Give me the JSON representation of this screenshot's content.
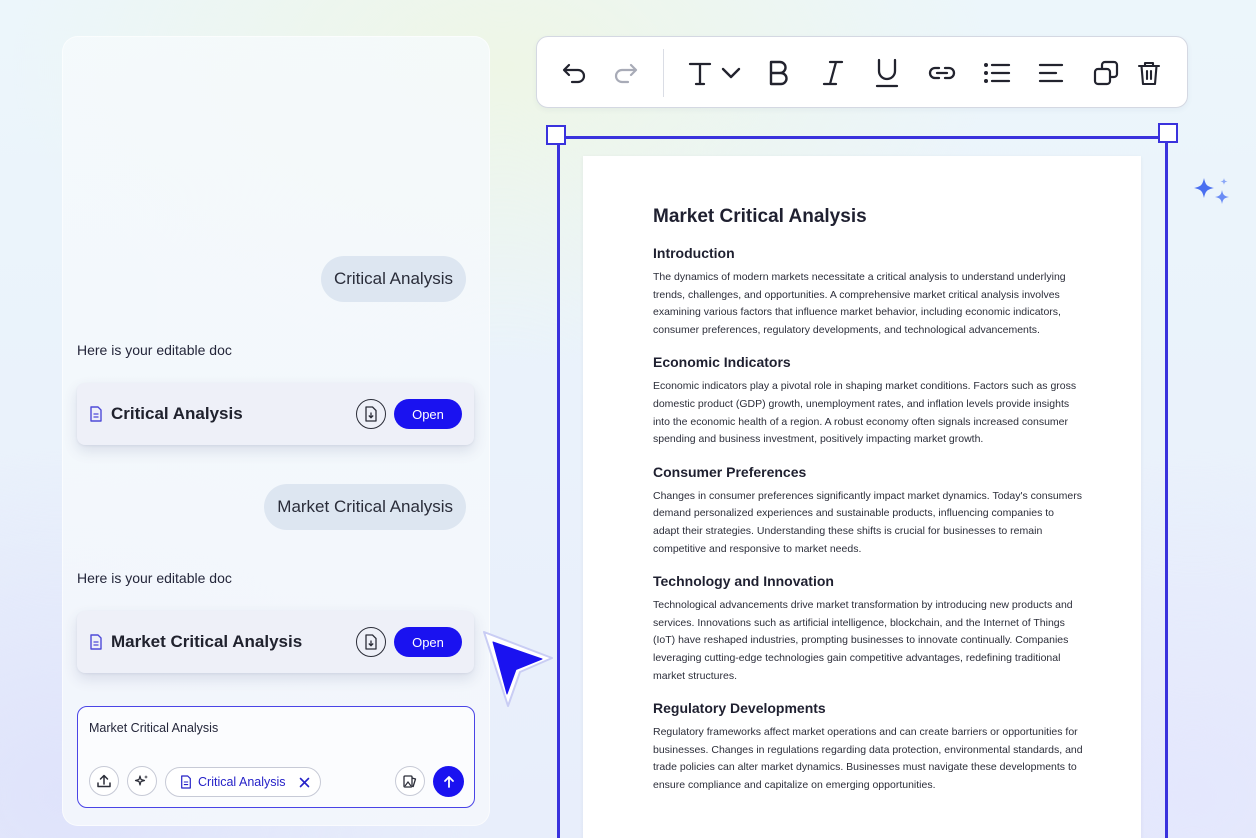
{
  "chat": {
    "messages": [
      {
        "role": "user",
        "text": "Critical Analysis"
      },
      {
        "role": "assistant",
        "text": "Here is your editable doc"
      },
      {
        "role": "user",
        "text": "Market Critical Analysis"
      },
      {
        "role": "assistant",
        "text": "Here is your editable doc"
      }
    ],
    "doc_cards": [
      {
        "title": "Critical Analysis",
        "open_label": "Open",
        "icon": "file-icon",
        "download_icon": "download-icon"
      },
      {
        "title": "Market Critical Analysis",
        "open_label": "Open",
        "icon": "file-icon",
        "download_icon": "download-icon"
      }
    ],
    "composer": {
      "value": "Market Critical Analysis",
      "attachment_chip": "Critical Analysis",
      "icons": [
        "upload-icon",
        "sparkle-icon",
        "file-icon",
        "close-icon",
        "gallery-icon",
        "arrow-up-icon"
      ]
    }
  },
  "toolbar": {
    "icons": [
      "undo-icon",
      "redo-icon",
      "text-style-icon",
      "chevron-down-icon",
      "bold-icon",
      "italic-icon",
      "underline-icon",
      "link-icon",
      "list-icon",
      "align-left-icon",
      "duplicate-icon",
      "trash-icon"
    ]
  },
  "document": {
    "title": "Market Critical Analysis",
    "sections": [
      {
        "heading": "Introduction",
        "body": "The dynamics of modern markets necessitate a critical analysis to understand underlying trends, challenges, and opportunities. A comprehensive market critical analysis involves examining various factors that influence market behavior, including economic indicators, consumer preferences, regulatory developments, and technological advancements."
      },
      {
        "heading": "Economic Indicators",
        "body": "Economic indicators play a pivotal role in shaping market conditions. Factors such as gross domestic product (GDP) growth, unemployment rates, and inflation levels provide insights into the economic health of a region. A robust economy often signals increased consumer spending and business investment, positively impacting market growth."
      },
      {
        "heading": "Consumer Preferences",
        "body": "Changes in consumer preferences significantly impact market dynamics. Today's consumers demand personalized experiences and sustainable products, influencing companies to adapt their strategies. Understanding these shifts is crucial for businesses to remain competitive and responsive to market needs."
      },
      {
        "heading": "Technology and Innovation",
        "body": "Technological advancements drive market transformation by introducing new products and services. Innovations such as artificial intelligence, blockchain, and the Internet of Things (IoT) have reshaped industries, prompting businesses to innovate continually. Companies leveraging cutting-edge technologies gain competitive advantages, redefining traditional market structures."
      },
      {
        "heading": "Regulatory Developments",
        "body": "Regulatory frameworks affect market operations and can create barriers or opportunities for businesses. Changes in regulations regarding data protection, environmental standards, and trade policies can alter market dynamics. Businesses must navigate these developments to ensure compliance and capitalize on emerging opportunities."
      }
    ]
  },
  "colors": {
    "accent": "#1a12f0",
    "selection": "#3a32dd",
    "bubble": "#dde6f1",
    "card": "#eef0f8"
  }
}
